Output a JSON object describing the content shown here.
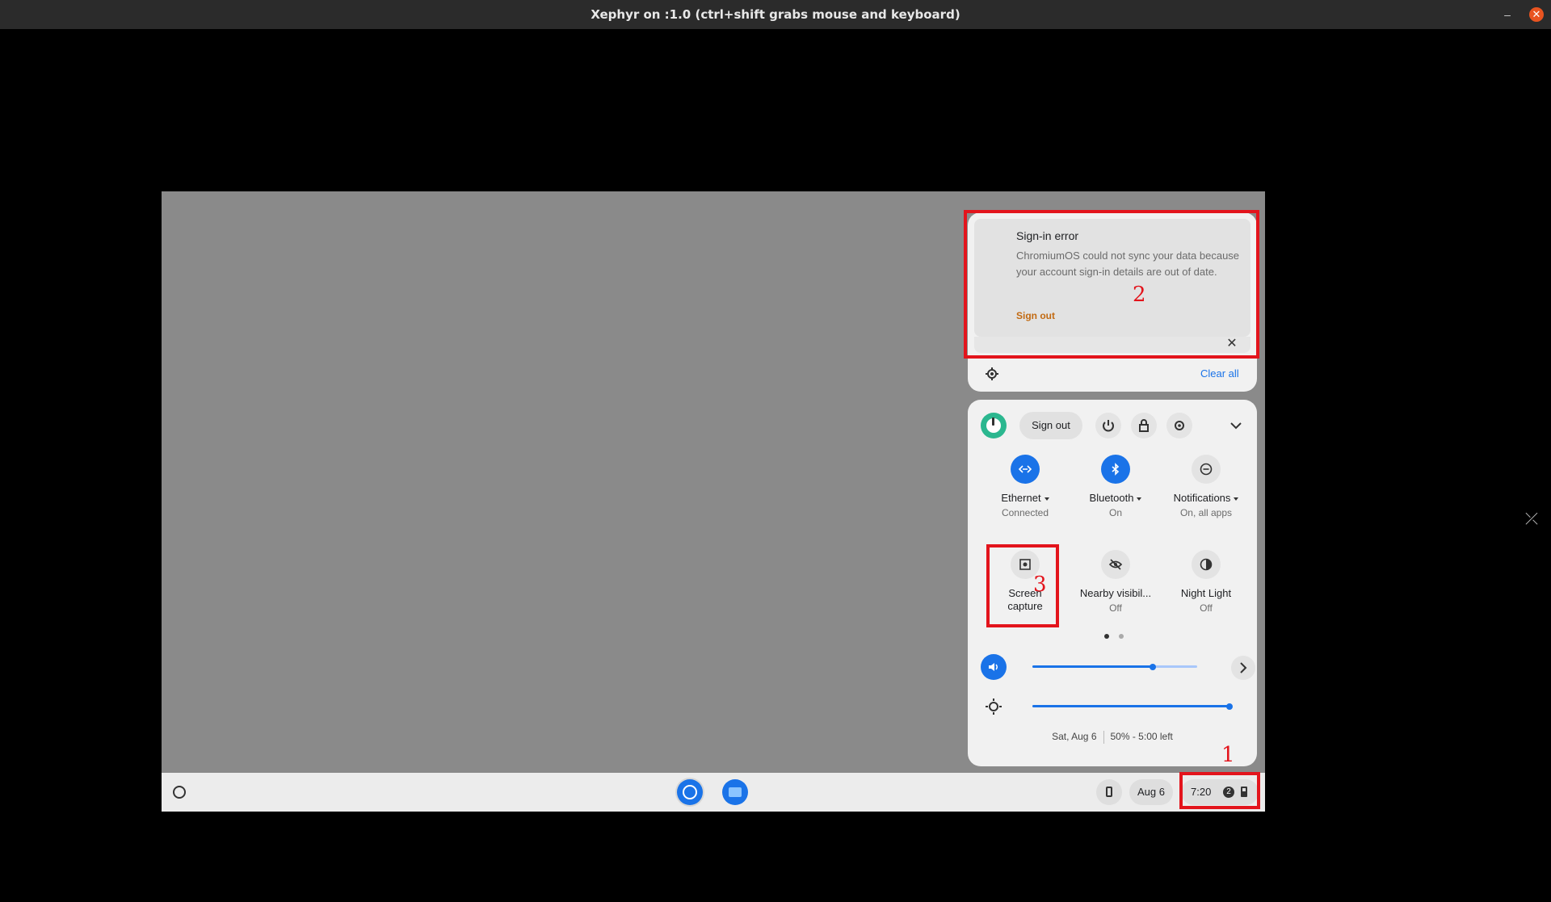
{
  "window": {
    "title": "Xephyr on :1.0 (ctrl+shift grabs mouse and keyboard)",
    "minimize": "–",
    "close": "✕",
    "side_close": "⤫"
  },
  "notification": {
    "title": "Sign-in error",
    "body": "ChromiumOS could not sync your data because your account sign-in details are out of date.",
    "action": "Sign out",
    "close": "✕",
    "clear_all": "Clear all"
  },
  "quick_settings": {
    "sign_out": "Sign out",
    "tiles": [
      {
        "label": "Ethernet",
        "sub": "Connected",
        "on": true,
        "icon": "ethernet-icon"
      },
      {
        "label": "Bluetooth",
        "sub": "On",
        "on": true,
        "icon": "bluetooth-icon"
      },
      {
        "label": "Notifications",
        "sub": "On, all apps",
        "on": false,
        "icon": "do-not-disturb-icon"
      },
      {
        "label": "Screen capture",
        "sub": "",
        "on": false,
        "icon": "screen-capture-icon"
      },
      {
        "label": "Nearby visibil...",
        "sub": "Off",
        "on": false,
        "icon": "nearby-visibility-icon"
      },
      {
        "label": "Night Light",
        "sub": "Off",
        "on": false,
        "icon": "night-light-icon"
      }
    ],
    "volume_level": 0.73,
    "brightness_level": 1.0,
    "page_count": 2,
    "active_page": 1,
    "date": "Sat, Aug 6",
    "battery": "50% - 5:00 left"
  },
  "shelf": {
    "date": "Aug 6",
    "time": "7:20",
    "notification_count": "2"
  },
  "annotations": [
    "1",
    "2",
    "3"
  ],
  "colors": {
    "accent": "#1a73e8",
    "marker": "#e3141c",
    "warning_link": "#c26a12"
  }
}
